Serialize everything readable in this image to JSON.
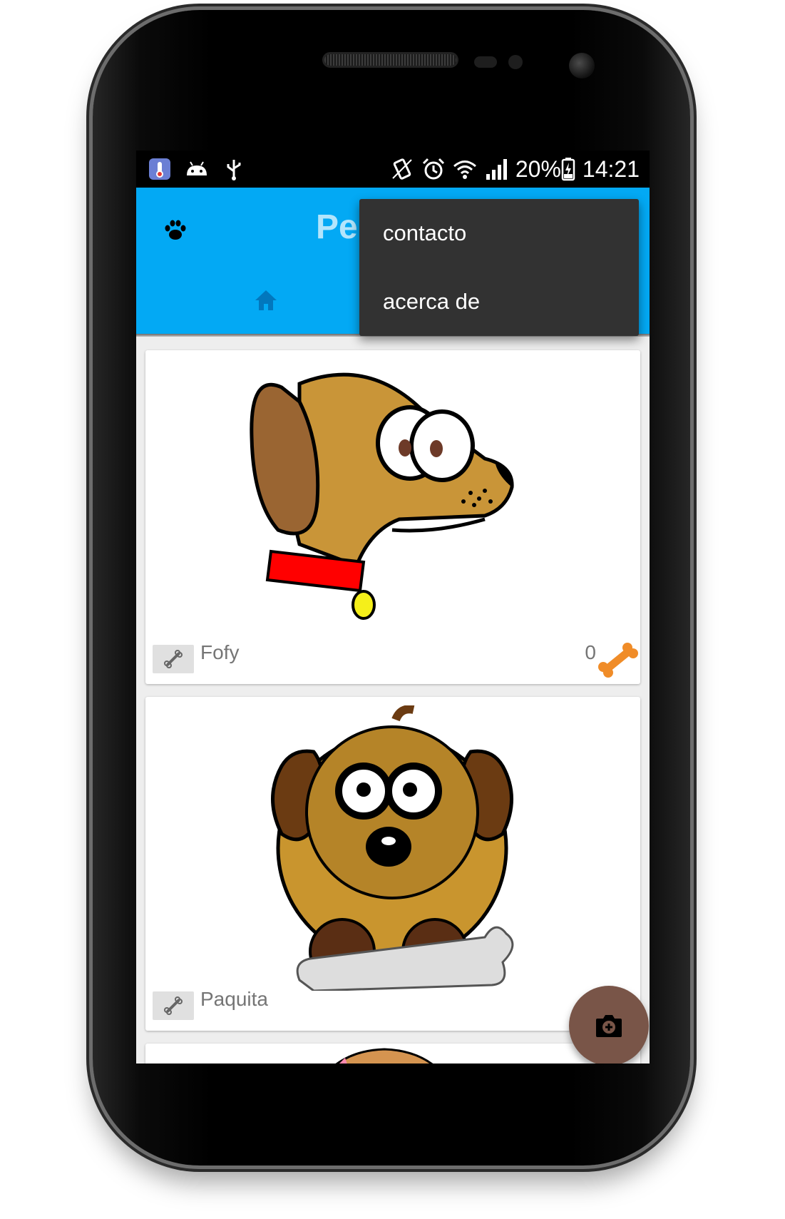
{
  "status_bar": {
    "left_icons": [
      "thermometer-app-icon",
      "android-icon",
      "usb-icon"
    ],
    "right_icons": [
      "vibrate-icon",
      "alarm-icon",
      "wifi-icon",
      "signal-icon"
    ],
    "battery": "20%",
    "time": "14:21"
  },
  "app_bar": {
    "title_visible": "Pe",
    "logo_icon": "paw-icon",
    "tabs": [
      {
        "icon": "home-icon",
        "selected": true
      }
    ],
    "color": "#03a9f4"
  },
  "overflow_menu": {
    "items": [
      {
        "label": "contacto"
      },
      {
        "label": "acerca de"
      }
    ]
  },
  "pets": [
    {
      "name": "Fofy",
      "rating": "0",
      "image": "cartoon-dog-side-icon",
      "shows_rating": true
    },
    {
      "name": "Paquita",
      "rating": "",
      "image": "cartoon-dog-front-icon",
      "shows_rating": false
    },
    {
      "name": "",
      "rating": "",
      "image": "cartoon-dog-partial-icon",
      "shows_rating": false
    }
  ],
  "fab": {
    "icon": "add-photo-camera-icon",
    "color": "#795548"
  }
}
